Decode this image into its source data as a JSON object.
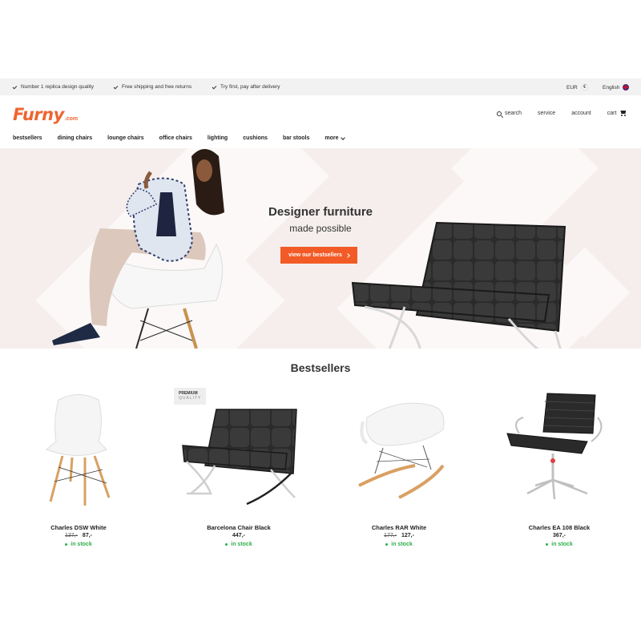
{
  "infobar": {
    "usps": [
      "Number 1 replica design quality",
      "Free shipping and free returns",
      "Try first, pay after delivery"
    ],
    "currency": "EUR",
    "currency_symbol": "€",
    "language": "English"
  },
  "header": {
    "logo": "Furny",
    "logo_suffix": ".com",
    "search": "search",
    "service": "service",
    "account": "account",
    "cart": "cart"
  },
  "nav": [
    "bestsellers",
    "dining chairs",
    "lounge chairs",
    "office chairs",
    "lighting",
    "cushions",
    "bar stools",
    "more"
  ],
  "hero": {
    "title": "Designer furniture",
    "subtitle": "made possible",
    "button": "view our bestsellers"
  },
  "bestsellers": {
    "title": "Bestsellers",
    "badge": "PREMIUM",
    "badge_sub": "QUALITY",
    "products": [
      {
        "name": "Charles DSW White",
        "old_price": "137,-",
        "price": "87,-",
        "stock": "in stock"
      },
      {
        "name": "Barcelona Chair Black",
        "old_price": "",
        "price": "447,-",
        "stock": "in stock"
      },
      {
        "name": "Charles RAR White",
        "old_price": "177,-",
        "price": "127,-",
        "stock": "in stock"
      },
      {
        "name": "Charles EA 108 Black",
        "old_price": "",
        "price": "367,-",
        "stock": "in stock"
      }
    ]
  },
  "colors": {
    "accent": "#ef6431",
    "button": "#f25b26",
    "stock": "#2cae4a",
    "hero_bg": "#f5eeed"
  }
}
